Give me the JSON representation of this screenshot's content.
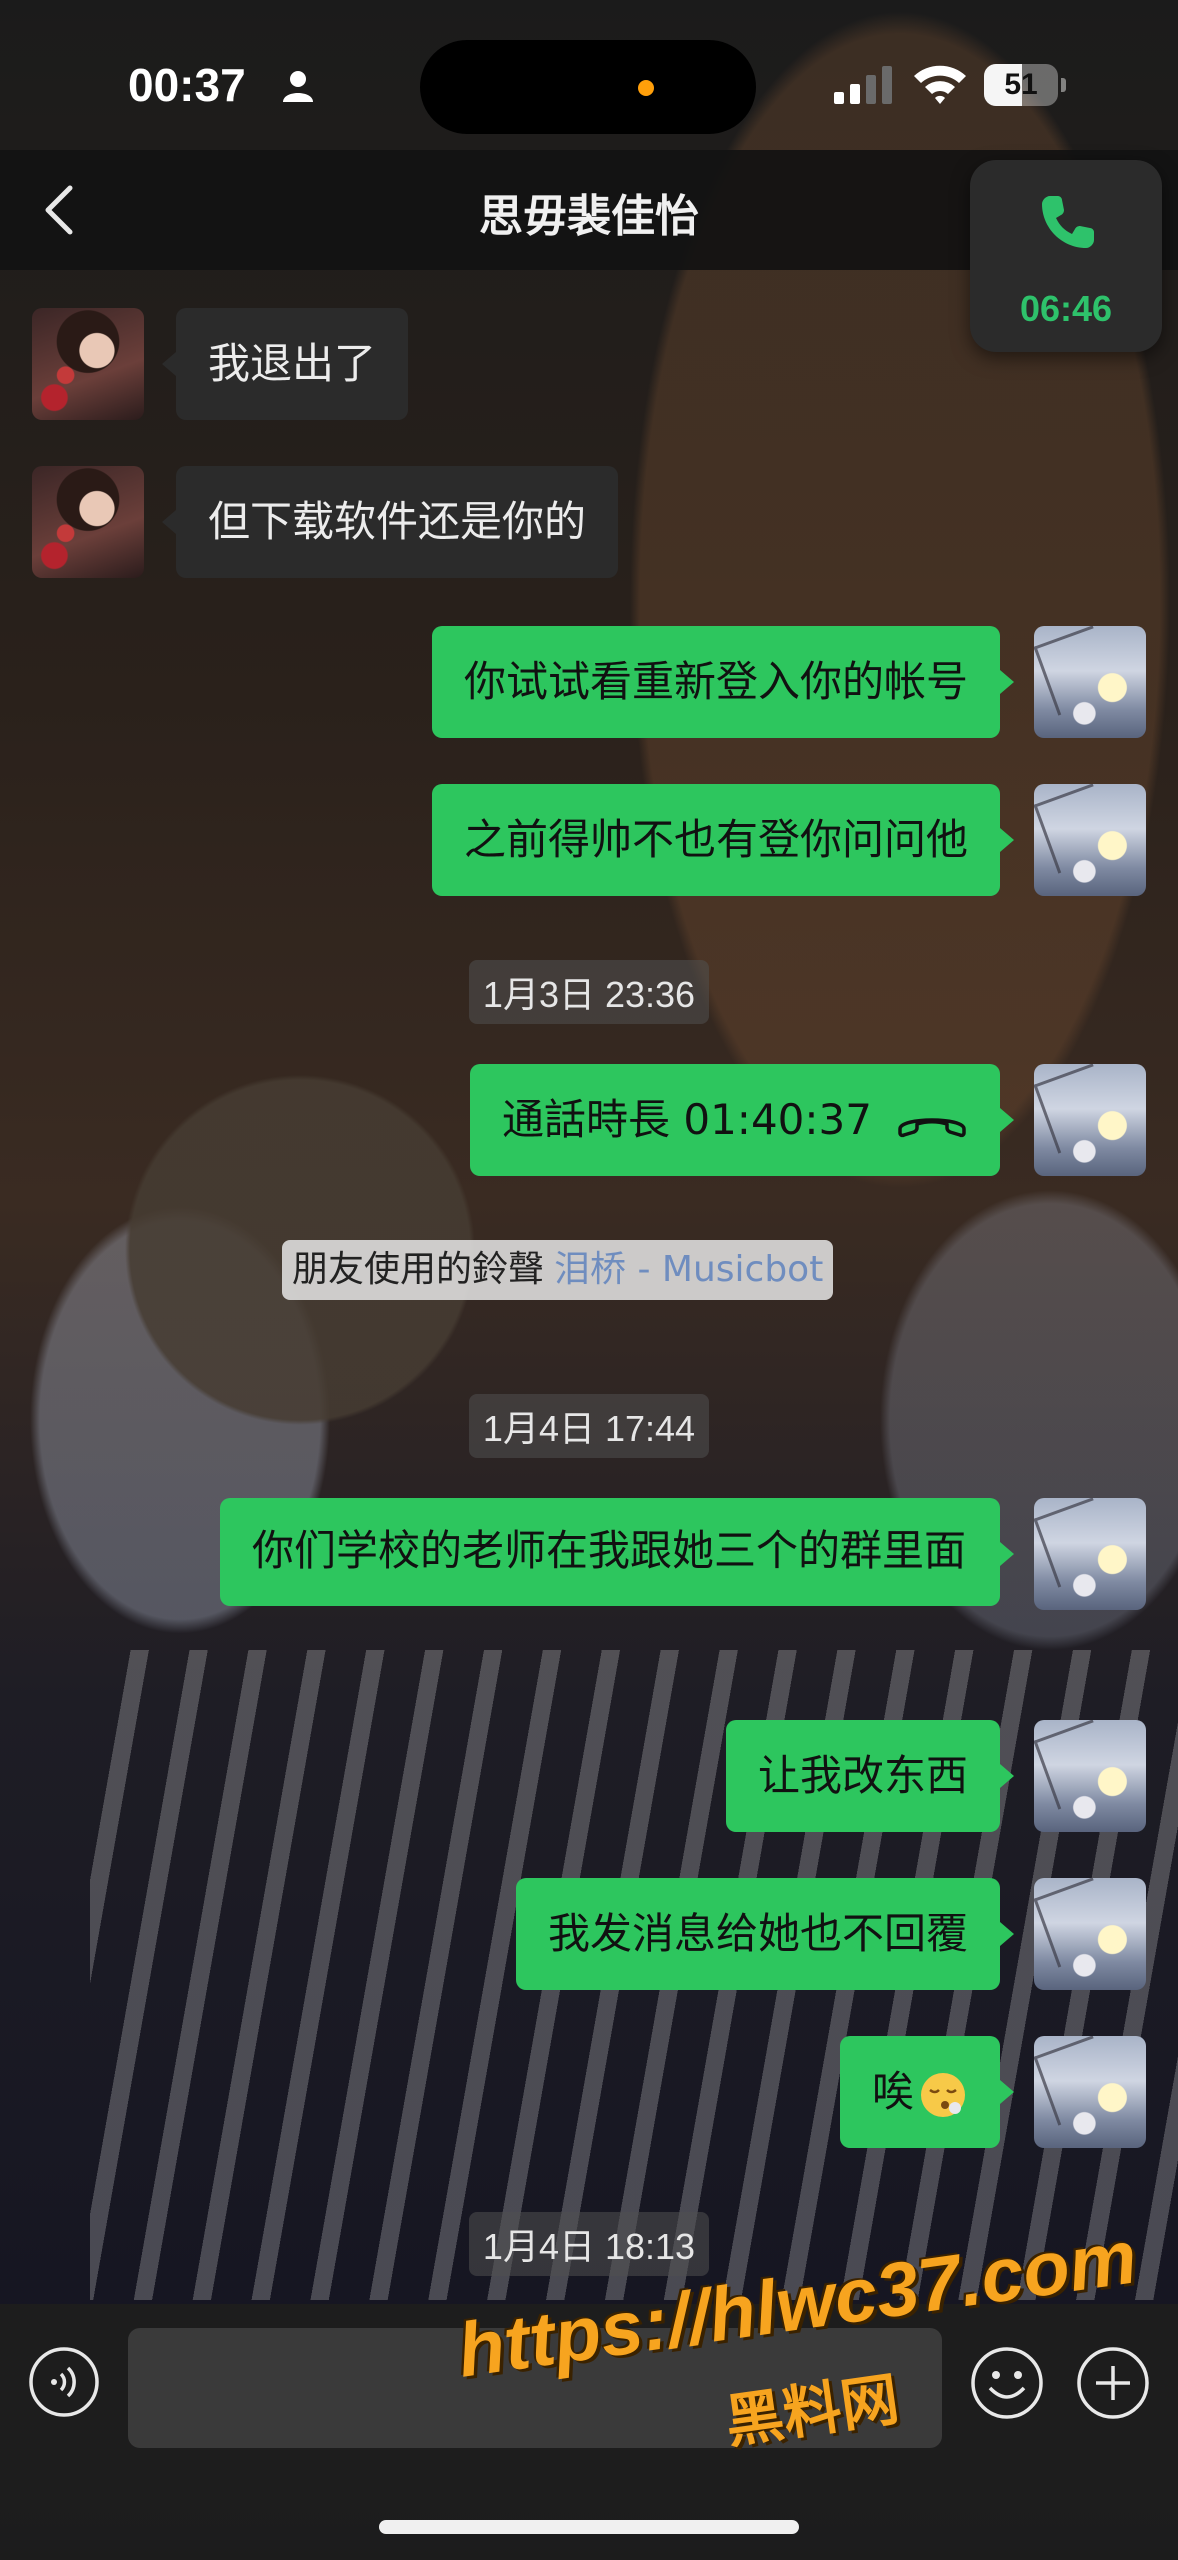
{
  "status_bar": {
    "time": "00:37",
    "battery_level": 51,
    "battery_text": "51"
  },
  "nav": {
    "title": "思毋裴佳怡",
    "back_icon": "chevron-left-icon"
  },
  "floating_call": {
    "icon": "phone-icon",
    "duration": "06:46",
    "accent_color": "#2ec26b"
  },
  "messages": [
    {
      "side": "in",
      "text": "我退出了"
    },
    {
      "side": "in",
      "text": "但下载软件还是你的"
    },
    {
      "side": "out",
      "text": "你试试看重新登入你的帐号"
    },
    {
      "side": "out",
      "text": "之前得帅不也有登你问问他"
    }
  ],
  "timestamps": [
    "1月3日 23:36",
    "1月4日 17:44",
    "1月4日 18:13"
  ],
  "call_record": {
    "text": "通話時長 01:40:37",
    "icon": "hang-up-icon"
  },
  "ringtone": {
    "label": "朋友使用的鈴聲",
    "song": "泪桥 - Musicbot"
  },
  "messages2": [
    {
      "side": "out",
      "text": "你们学校的老师在我跟她三个的群里面"
    },
    {
      "side": "out",
      "text": "让我改东西"
    },
    {
      "side": "out",
      "text": "我发消息给她也不回覆"
    },
    {
      "side": "out",
      "text": "唉",
      "emoji": "sighing-face-emoji"
    }
  ],
  "input_bar": {
    "voice_icon": "voice-icon",
    "emoji_icon": "smiley-icon",
    "plus_icon": "plus-icon"
  },
  "watermark": {
    "url": "https://hlwc37.com",
    "name": "黑料网"
  },
  "colors": {
    "outgoing_bubble": "#2dc65e",
    "incoming_bubble": "#2c2c2c"
  }
}
